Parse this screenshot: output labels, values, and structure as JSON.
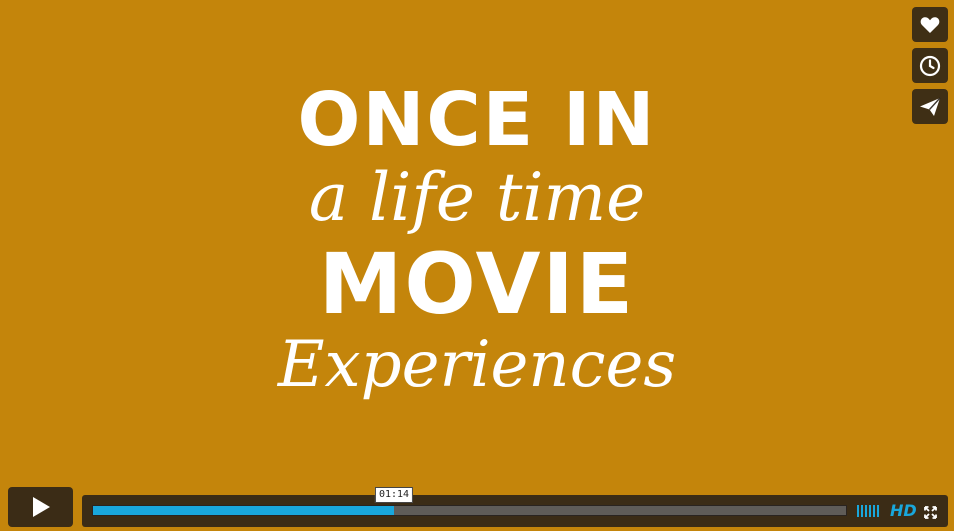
{
  "video": {
    "title_lines": [
      "ONCE IN",
      "a life time",
      "MOVIE",
      "Experiences"
    ],
    "background_color": "#c4850b"
  },
  "side_actions": [
    {
      "name": "like",
      "icon": "heart-icon"
    },
    {
      "name": "watch-later",
      "icon": "clock-icon"
    },
    {
      "name": "share",
      "icon": "paper-plane-icon"
    }
  ],
  "controls": {
    "play_icon": "play-icon",
    "progress_fraction": 0.4,
    "time_tooltip": "01:14",
    "hd_label": "HD",
    "volume_icon": "volume-bars-icon",
    "fullscreen_icon": "fullscreen-icon",
    "accent_color": "#19a7dc"
  }
}
